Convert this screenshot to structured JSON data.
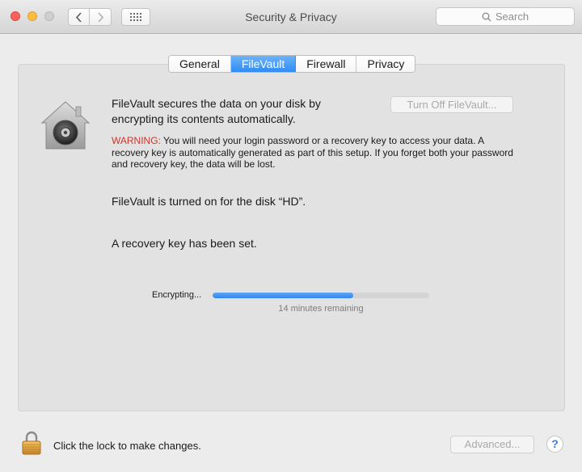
{
  "window": {
    "title": "Security & Privacy"
  },
  "toolbar": {
    "back_icon": "chevron-left-icon",
    "forward_icon": "chevron-right-icon",
    "grid_icon": "grid-icon"
  },
  "search": {
    "placeholder": "Search",
    "icon": "search-icon"
  },
  "tabs": [
    {
      "label": "General",
      "active": false
    },
    {
      "label": "FileVault",
      "active": true
    },
    {
      "label": "Firewall",
      "active": false
    },
    {
      "label": "Privacy",
      "active": false
    }
  ],
  "filevault": {
    "intro": "FileVault secures the data on your disk by encrypting its contents automatically.",
    "turn_off_label": "Turn Off FileVault...",
    "warning_label": "WARNING:",
    "warning_text": " You will need your login password or a recovery key to access your data. A recovery key is automatically generated as part of this setup. If you forget both your password and recovery key, the data will be lost.",
    "status_disk": "FileVault is turned on for the disk “HD”.",
    "status_recovery": "A recovery key has been set.",
    "encrypting_label": "Encrypting...",
    "progress_fraction": 0.65,
    "remaining": "14 minutes remaining"
  },
  "footer": {
    "lock_text": "Click the lock to make changes.",
    "advanced_label": "Advanced...",
    "help_label": "?"
  },
  "colors": {
    "accent": "#2f8cf6",
    "warning": "#d0352b"
  }
}
